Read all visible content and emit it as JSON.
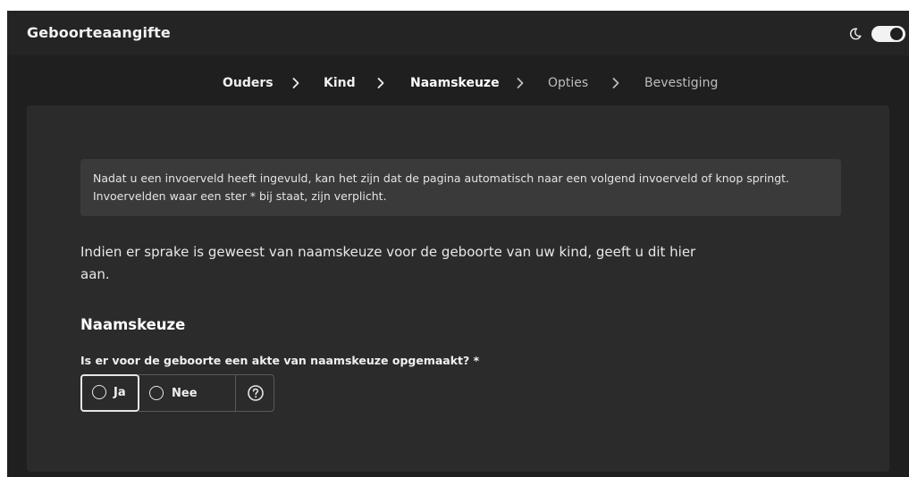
{
  "app": {
    "title": "Geboorteaangifte"
  },
  "header": {
    "theme_icon": "moon-icon",
    "theme_toggle": "on"
  },
  "steps": [
    {
      "label": "Ouders",
      "state": "done"
    },
    {
      "label": "Kind",
      "state": "done"
    },
    {
      "label": "Naamskeuze",
      "state": "current"
    },
    {
      "label": "Opties",
      "state": "upcoming"
    },
    {
      "label": "Bevestiging",
      "state": "upcoming"
    }
  ],
  "notice": {
    "line1": "Nadat u een invoerveld heeft ingevuld, kan het zijn dat de pagina automatisch naar een volgend invoerveld of knop springt.",
    "line2": "Invoervelden waar een ster * bij staat, zijn verplicht."
  },
  "intro": {
    "text": "Indien er sprake is geweest van naamskeuze voor de geboorte van uw kind, geeft u dit hier aan."
  },
  "section": {
    "title": "Naamskeuze"
  },
  "question": {
    "label": "Is er voor de geboorte een akte van naamskeuze opgemaakt? *",
    "options": [
      {
        "label": "Ja",
        "focused": true,
        "selected": false
      },
      {
        "label": "Nee",
        "focused": false,
        "selected": false
      }
    ],
    "help_icon": "question-circle-icon"
  },
  "colors": {
    "background": "#1f1f1f",
    "topbar": "#242424",
    "card": "#2b2b2b",
    "notice": "#3a3a3a",
    "text": "#f0f0f0"
  }
}
